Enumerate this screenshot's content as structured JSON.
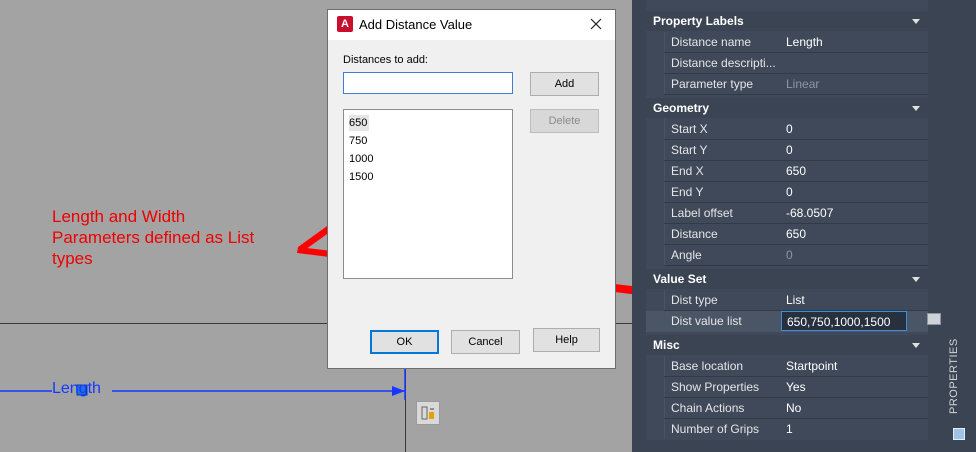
{
  "canvas": {
    "dimension_label": "Length",
    "annotation_lines": [
      "Length and Width",
      "Parameters defined as List",
      "types"
    ],
    "colors": {
      "dimension": "#1438ff",
      "annotation": "#ee0000"
    }
  },
  "dialog": {
    "title": "Add Distance Value",
    "app_icon_letter": "A",
    "distances_label": "Distances to add:",
    "input_value": "",
    "list_items": [
      "650",
      "750",
      "1000",
      "1500"
    ],
    "add_label": "Add",
    "delete_label": "Delete",
    "ok_label": "OK",
    "cancel_label": "Cancel",
    "help_label": "Help"
  },
  "panel": {
    "property_labels": {
      "header": "Property Labels",
      "rows": [
        {
          "name": "Distance name",
          "value": "Length"
        },
        {
          "name": "Distance descripti...",
          "value": ""
        },
        {
          "name": "Parameter type",
          "value": "Linear"
        }
      ]
    },
    "geometry": {
      "header": "Geometry",
      "rows": [
        {
          "name": "Start X",
          "value": "0"
        },
        {
          "name": "Start Y",
          "value": "0"
        },
        {
          "name": "End X",
          "value": "650"
        },
        {
          "name": "End Y",
          "value": "0"
        },
        {
          "name": "Label offset",
          "value": "-68.0507"
        },
        {
          "name": "Distance",
          "value": "650"
        },
        {
          "name": "Angle",
          "value": "0"
        }
      ]
    },
    "value_set": {
      "header": "Value Set",
      "rows": [
        {
          "name": "Dist type",
          "value": "List"
        },
        {
          "name": "Dist value list",
          "value": "650,750,1000,1500"
        }
      ]
    },
    "misc": {
      "header": "Misc",
      "rows": [
        {
          "name": "Base location",
          "value": "Startpoint"
        },
        {
          "name": "Show Properties",
          "value": "Yes"
        },
        {
          "name": "Chain Actions",
          "value": "No"
        },
        {
          "name": "Number of Grips",
          "value": "1"
        }
      ]
    },
    "side_tab_label": "PROPERTIES"
  }
}
